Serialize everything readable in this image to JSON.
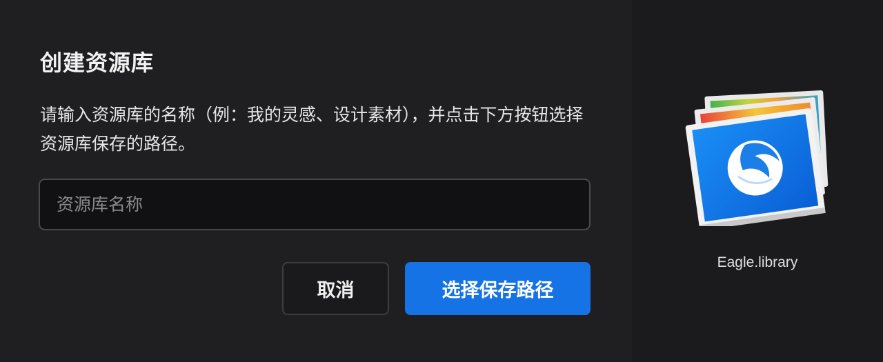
{
  "dialog": {
    "title": "创建资源库",
    "description": "请输入资源库的名称（例：我的灵感、设计素材），并点击下方按钮选择资源库保存的路径。",
    "input": {
      "value": "",
      "placeholder": "资源库名称"
    },
    "buttons": {
      "cancel_label": "取消",
      "primary_label": "选择保存路径"
    }
  },
  "preview": {
    "icon": "eagle-library-icon",
    "filename": "Eagle.library"
  },
  "colors": {
    "background": "#1f1f22",
    "side_background": "#1b1b1d",
    "primary": "#1673e6"
  }
}
